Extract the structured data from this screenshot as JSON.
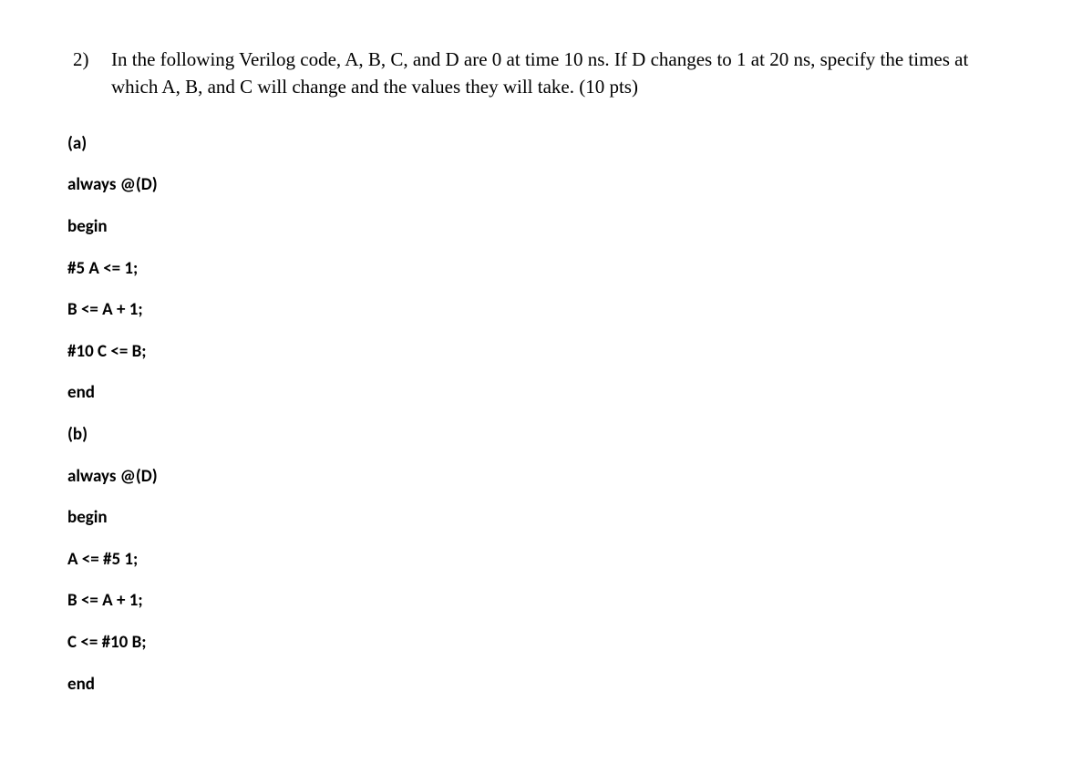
{
  "question": {
    "number": "2)",
    "prompt": "In the following Verilog code, A, B, C, and D are 0 at time 10 ns. If D changes to 1 at 20 ns, specify the times at which A, B, and C will change and the values they will take. (10 pts)"
  },
  "parts": {
    "a": {
      "label": "(a)",
      "lines": [
        "always @(D)",
        "begin",
        "#5 A <= 1;",
        "B <= A + 1;",
        "#10 C <= B;",
        "end"
      ]
    },
    "b": {
      "label": "(b)",
      "lines": [
        "always @(D)",
        "begin",
        "A <= #5 1;",
        "B <= A + 1;",
        "C <= #10 B;",
        "end"
      ]
    }
  }
}
